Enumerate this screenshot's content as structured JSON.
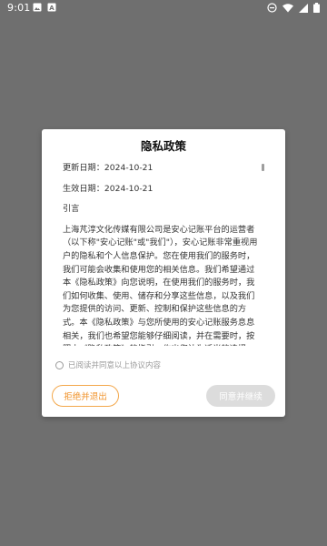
{
  "status_bar": {
    "time": "9:01",
    "left_icons": [
      "image-icon",
      "accessibility-icon"
    ],
    "right_icons": [
      "do-not-disturb-icon",
      "wifi-icon",
      "signal-icon",
      "battery-icon"
    ]
  },
  "dialog": {
    "title": "隐私政策",
    "update_date": "更新日期：2024-10-21",
    "effective_date": "生效日期：2024-10-21",
    "intro_heading": "引言",
    "body": "上海芃淳文化传媒有限公司是安心记账平台的运营者（以下称\"安心记账\"或\"我们\"），安心记账非常重视用户的隐私和个人信息保护。您在使用我们的服务时，我们可能会收集和使用您的相关信息。我们希望通过本《隐私政策》向您说明，在使用我们的服务时，我们如何收集、使用、储存和分享这些信息，以及我们为您提供的访问、更新、控制和保护这些信息的方式。本《隐私政策》与您所使用的安心记账服务息息相关，我们也希望您能够仔细阅读，并在需要时，按照本《隐私政策》的指引，作出您认为适当的选择。",
    "agree_label": "已阅读并同意以上协议内容",
    "reject_button": "拒绝并退出",
    "accept_button": "同意并继续"
  },
  "colors": {
    "backdrop": "#6f6f6f",
    "accent_orange": "#f0932b",
    "disabled_button": "#dcdcdc"
  }
}
